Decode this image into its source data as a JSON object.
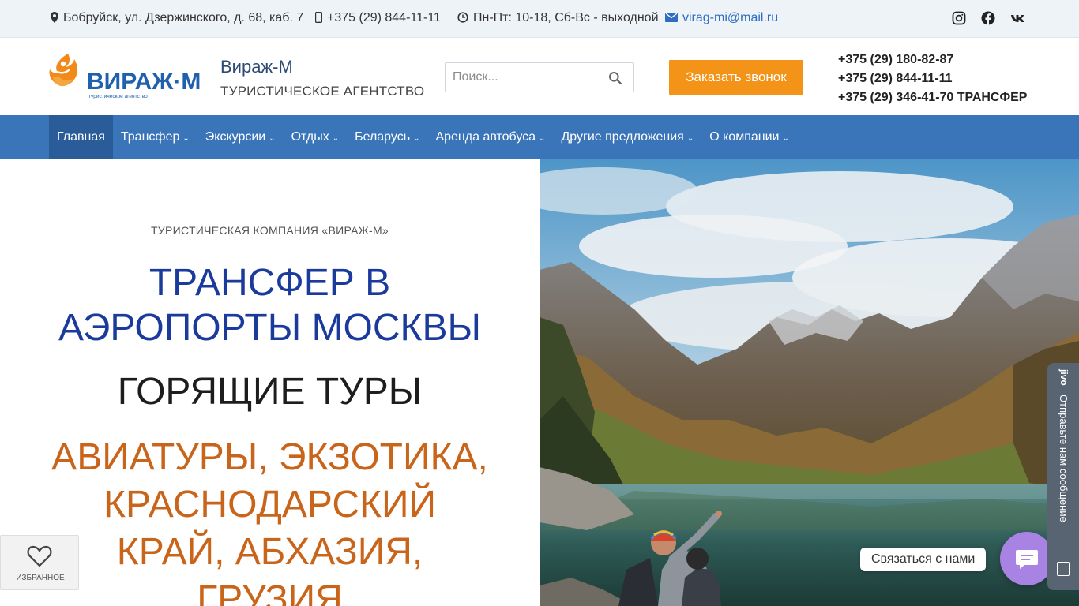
{
  "topbar": {
    "address": "Бобруйск, ул. Дзержинского, д. 68, каб. 7",
    "phone": "+375 (29) 844-11-11",
    "hours": "Пн-Пт: 10-18, Сб-Вс - выходной",
    "email": "virag-mi@mail.ru",
    "socials": [
      "instagram-icon",
      "facebook-icon",
      "vk-icon"
    ]
  },
  "header": {
    "logo_text": "ВИРАЖ·М",
    "logo_tagline": "туристическое агентство",
    "brand_title": "Вираж-М",
    "brand_subtitle": "ТУРИСТИЧЕСКОЕ АГЕНТСТВО",
    "search_placeholder": "Поиск...",
    "callback_label": "Заказать звонок",
    "phones": [
      "+375 (29) 180-82-87",
      "+375 (29) 844-11-11",
      "+375 (29) 346-41-70 ТРАНСФЕР"
    ]
  },
  "nav": {
    "items": [
      {
        "label": "Главная",
        "dropdown": false
      },
      {
        "label": "Трансфер",
        "dropdown": true
      },
      {
        "label": "Экскурсии",
        "dropdown": true
      },
      {
        "label": "Отдых",
        "dropdown": true
      },
      {
        "label": "Беларусь",
        "dropdown": true
      },
      {
        "label": "Аренда автобуса",
        "dropdown": true
      },
      {
        "label": "Другие предложения",
        "dropdown": true
      },
      {
        "label": "О компании",
        "dropdown": true
      }
    ]
  },
  "hero": {
    "kicker": "ТУРИСТИЧЕСКАЯ КОМПАНИЯ «ВИРАЖ-М»",
    "line_blue_1": "ТРАНСФЕР В",
    "line_blue_2": "АЭРОПОРТЫ МОСКВЫ",
    "line_dark": "ГОРЯЩИЕ ТУРЫ",
    "line_orange_1": "АВИАТУРЫ, ЭКЗОТИКА,",
    "line_orange_2": "КРАСНОДАРСКИЙ",
    "line_orange_3": "КРАЙ, АБХАЗИЯ,",
    "line_orange_4": "ГРУЗИЯ"
  },
  "favorites": {
    "label": "ИЗБРАННОЕ"
  },
  "chat": {
    "label": "Связаться с нами",
    "jivo_text": "Отправьте нам сообщение",
    "jivo_brand": "jivo"
  },
  "colors": {
    "accent_orange": "#f39317",
    "nav_blue": "#3a74b9",
    "nav_active": "#2a5c9a",
    "heading_blue": "#1a3a9c",
    "heading_orange": "#c9651a",
    "chat_purple": "#a883e3"
  }
}
